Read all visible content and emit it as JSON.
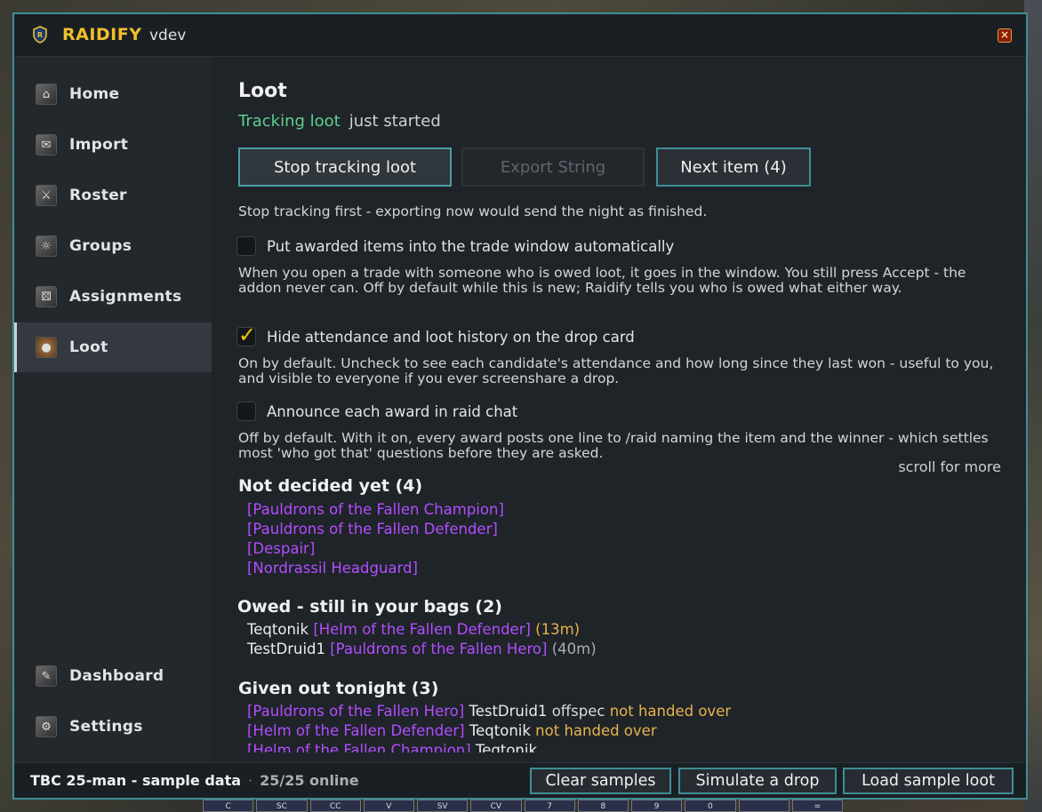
{
  "app": {
    "name": "RAIDIFY",
    "version": "vdev"
  },
  "sidebar": {
    "items": [
      {
        "label": "Home",
        "icon": "home-icon"
      },
      {
        "label": "Import",
        "icon": "import-icon"
      },
      {
        "label": "Roster",
        "icon": "roster-icon"
      },
      {
        "label": "Groups",
        "icon": "groups-icon"
      },
      {
        "label": "Assignments",
        "icon": "assignments-icon"
      },
      {
        "label": "Loot",
        "icon": "loot-bag-icon",
        "active": true
      }
    ],
    "bottom_items": [
      {
        "label": "Dashboard",
        "icon": "dashboard-icon"
      },
      {
        "label": "Settings",
        "icon": "settings-icon"
      }
    ]
  },
  "main": {
    "title": "Loot",
    "tracking_label": "Tracking loot",
    "tracking_state": "just started",
    "buttons": {
      "stop": "Stop tracking loot",
      "export": "Export String",
      "next": "Next item (4)"
    },
    "export_hint": "Stop tracking first - exporting now would send the night as finished.",
    "options": [
      {
        "label": "Put awarded items into the trade window automatically",
        "checked": false,
        "description": "When you open a trade with someone who is owed loot, it goes in the window. You still press Accept - the addon never can. Off by default while this is new; Raidify tells you who is owed what either way."
      },
      {
        "label": "Hide attendance and loot history on the drop card",
        "checked": true,
        "description": "On by default. Uncheck to see each candidate's attendance and how long since they last won - useful to you, and visible to everyone if you ever screenshare a drop."
      },
      {
        "label": "Announce each award in raid chat",
        "checked": false,
        "description": "Off by default. With it on, every award posts one line to /raid naming the item and the winner - which settles most 'who got that' questions before they are asked."
      }
    ],
    "scroll_hint": "scroll for more",
    "not_decided": {
      "heading": "Not decided yet (4)",
      "items": [
        "[Pauldrons of the Fallen Champion]",
        "[Pauldrons of the Fallen Defender]",
        "[Despair]",
        "[Nordrassil Headguard]"
      ]
    },
    "owed": {
      "heading": "Owed - still in your bags (2)",
      "rows": [
        {
          "player": "Teqtonik",
          "item": "[Helm of the Fallen Defender]",
          "time": "(13m)"
        },
        {
          "player": "TestDruid1",
          "item": "[Pauldrons of the Fallen Hero]",
          "time": "(40m)"
        }
      ]
    },
    "given": {
      "heading": "Given out tonight (3)",
      "rows": [
        {
          "item": "[Pauldrons of the Fallen Hero]",
          "player": "TestDruid1",
          "spec": "offspec",
          "status": "not handed over"
        },
        {
          "item": "[Helm of the Fallen Defender]",
          "player": "Teqtonik",
          "spec": "",
          "status": "not handed over"
        },
        {
          "item": "[Helm of the Fallen Champion]",
          "player": "Teqtonik",
          "spec": "",
          "status": ""
        }
      ]
    }
  },
  "statusbar": {
    "raid": "TBC 25-man - sample data",
    "separator": "·",
    "online": "25/25 online",
    "buttons": {
      "clear": "Clear samples",
      "simulate": "Simulate a drop",
      "load": "Load sample loot"
    }
  },
  "actionbar": [
    "C",
    "SC",
    "CC",
    "V",
    "SV",
    "CV",
    "7",
    "8",
    "9",
    "0",
    "",
    "="
  ],
  "colors": {
    "accent": "#3e8e95",
    "brand": "#f0bf2b",
    "epic": "#b34dff",
    "tracking": "#5fcf8f",
    "warning": "#e8b44a"
  }
}
